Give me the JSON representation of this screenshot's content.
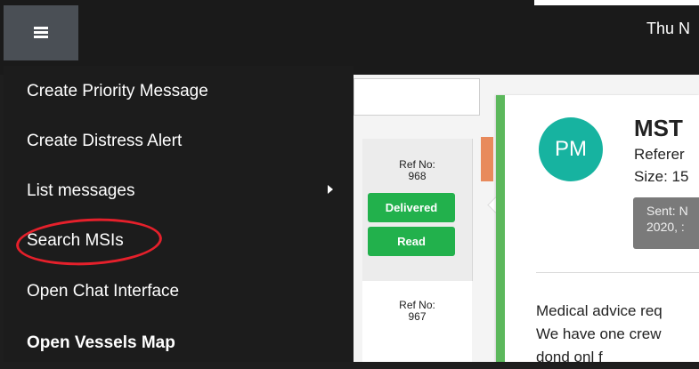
{
  "header": {
    "date_text": "Thu N"
  },
  "menu": {
    "items": [
      {
        "label": "Create Priority Message"
      },
      {
        "label": "Create Distress Alert"
      },
      {
        "label": "List messages"
      },
      {
        "label": "Search MSIs"
      },
      {
        "label": "Open Chat Interface"
      },
      {
        "label": "Open Vessels Map"
      }
    ]
  },
  "messages": [
    {
      "ref_label": "Ref No:",
      "ref_no": "968",
      "status": [
        "Delivered",
        "Read"
      ]
    },
    {
      "ref_label": "Ref No:",
      "ref_no": "967"
    }
  ],
  "detail": {
    "avatar_initials": "PM",
    "sender": "MST",
    "reference": "Referer",
    "size": "Size: 15",
    "sent_line1": "Sent: N",
    "sent_line2": "2020, :",
    "body_line1": "Medical advice req",
    "body_line2": "We have one crew",
    "body_line3": "dond onl f"
  },
  "colors": {
    "accent_green": "#22b14c",
    "card_border": "#5cb85c",
    "avatar_teal": "#17b3a0",
    "highlight_red": "#e5202b",
    "orange_tab": "#e88a5c"
  }
}
